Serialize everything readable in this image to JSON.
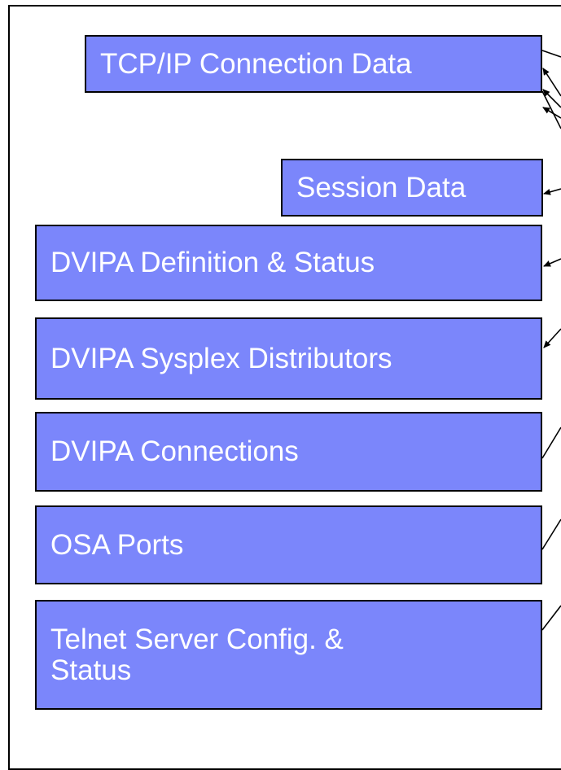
{
  "diagram": {
    "boxes": [
      {
        "id": "tcpip",
        "label": "TCP/IP Connection Data"
      },
      {
        "id": "session",
        "label": "Session Data"
      },
      {
        "id": "dvipa-def",
        "label": "DVIPA Definition & Status"
      },
      {
        "id": "dvipa-sysplex",
        "label": "DVIPA Sysplex Distributors"
      },
      {
        "id": "dvipa-conn",
        "label": "DVIPA Connections"
      },
      {
        "id": "osa",
        "label": "OSA Ports"
      },
      {
        "id": "telnet",
        "label_line1": "Telnet Server Config. &",
        "label_line2": "Status"
      }
    ],
    "colors": {
      "box_fill": "#7b86fb",
      "box_text": "#ffffff",
      "border": "#000000"
    }
  }
}
